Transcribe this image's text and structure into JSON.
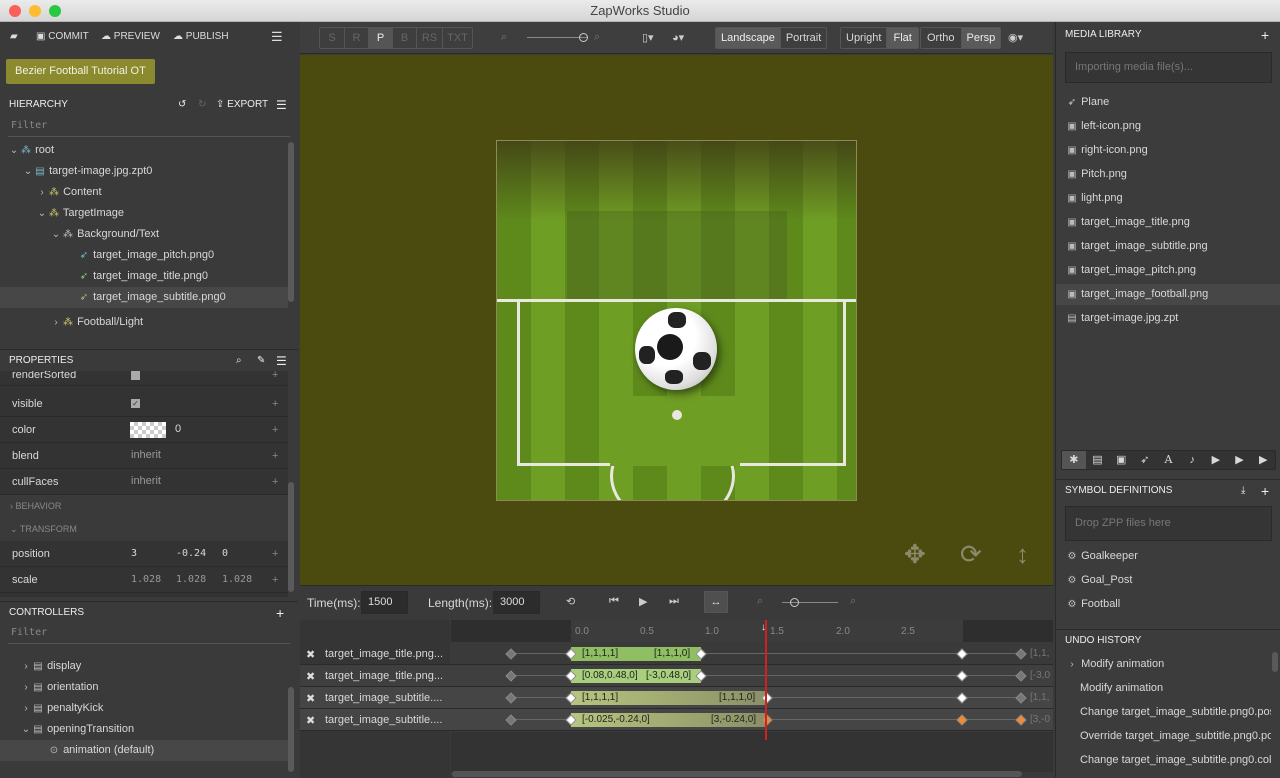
{
  "window": {
    "title": "ZapWorks Studio"
  },
  "toolbar": {
    "commit": "COMMIT",
    "preview": "PREVIEW",
    "publish": "PUBLISH",
    "project": "Bezier Football Tutorial OT"
  },
  "view": {
    "modes": [
      "S",
      "R",
      "P",
      "B",
      "RS",
      "TXT"
    ],
    "active_mode": "P",
    "landscape": "Landscape",
    "portrait": "Portrait",
    "upright": "Upright",
    "flat": "Flat",
    "ortho": "Ortho",
    "persp": "Persp"
  },
  "hierarchy": {
    "title": "HIERARCHY",
    "export": "EXPORT",
    "filter": "Filter",
    "items": [
      "root",
      "target-image.jpg.zpt0",
      "Content",
      "TargetImage",
      "Background/Text",
      "target_image_pitch.png0",
      "target_image_title.png0",
      "target_image_subtitle.png0",
      "Football/Light"
    ]
  },
  "properties": {
    "title": "PROPERTIES",
    "rows": [
      {
        "name": "renderSorted",
        "value": ""
      },
      {
        "name": "visible",
        "value": ""
      },
      {
        "name": "color",
        "value": "0"
      },
      {
        "name": "blend",
        "value": "inherit"
      },
      {
        "name": "cullFaces",
        "value": "inherit"
      }
    ],
    "behavior": "BEHAVIOR",
    "transform": "TRANSFORM",
    "position": {
      "label": "position",
      "x": "3",
      "y": "-0.24",
      "z": "0"
    },
    "scale": {
      "label": "scale",
      "x": "1.028",
      "y": "1.028",
      "z": "1.028"
    }
  },
  "controllers": {
    "title": "CONTROLLERS",
    "filter": "Filter",
    "items": [
      "display",
      "orientation",
      "penaltyKick",
      "openingTransition",
      "animation (default)"
    ]
  },
  "timeline": {
    "time_label": "Time(ms):",
    "time": "1500",
    "length_label": "Length(ms):",
    "length": "3000",
    "ticks": [
      "0.0",
      "0.5",
      "1.0",
      "1.5",
      "2.0",
      "2.5"
    ],
    "tracks": [
      {
        "name": "target_image_title.png...",
        "k1": "[1,1,1,1]",
        "k2": "[1,1,1,0]",
        "end": "[1,1,"
      },
      {
        "name": "target_image_title.png...",
        "k1": "[0.08,0.48,0]",
        "k2": "[-3,0.48,0]",
        "end": "[-3,0"
      },
      {
        "name": "target_image_subtitle....",
        "k1": "[1,1,1,1]",
        "k2": "[1,1,1,0]",
        "end": "[1,1,"
      },
      {
        "name": "target_image_subtitle....",
        "k1": "[-0.025,-0.24,0]",
        "k2": "[3,-0.24,0]",
        "end": "[3,-0"
      }
    ]
  },
  "media": {
    "title": "MEDIA LIBRARY",
    "placeholder": "Importing media file(s)...",
    "items": [
      "Plane",
      "left-icon.png",
      "right-icon.png",
      "Pitch.png",
      "light.png",
      "target_image_title.png",
      "target_image_subtitle.png",
      "target_image_pitch.png",
      "target_image_football.png",
      "target-image.jpg.zpt"
    ]
  },
  "symbols": {
    "title": "SYMBOL DEFINITIONS",
    "placeholder": "Drop ZPP files here",
    "items": [
      "Goalkeeper",
      "Goal_Post",
      "Football"
    ]
  },
  "undo": {
    "title": "UNDO HISTORY",
    "items": [
      "Modify animation",
      "Modify animation",
      "Change target_image_subtitle.png0.pos",
      "Override target_image_subtitle.png0.po",
      "Change target_image_subtitle.png0.col"
    ]
  },
  "colors": {
    "viewport": "#4b4a0f",
    "accent": "#8b8a2e",
    "playhead": "#d02020"
  }
}
